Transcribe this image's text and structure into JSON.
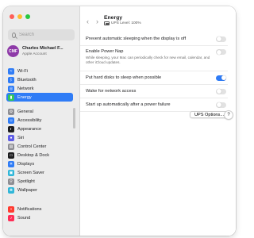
{
  "window": {
    "traffic_lights": [
      {
        "name": "close",
        "color": "#ff5f57"
      },
      {
        "name": "minimize",
        "color": "#febc2e"
      },
      {
        "name": "zoom",
        "color": "#28c840"
      }
    ]
  },
  "sidebar": {
    "search_placeholder": "Search",
    "account": {
      "initials": "CMF",
      "name": "Charles Michael F...",
      "subtitle": "Apple Account"
    },
    "groups": [
      {
        "items": [
          {
            "label": "Wi-Fi",
            "icon": "wifi-icon",
            "color": "#2f7cf6",
            "glyph": "≈",
            "selected": false
          },
          {
            "label": "Bluetooth",
            "icon": "bluetooth-icon",
            "color": "#2f7cf6",
            "glyph": "ᛒ",
            "selected": false
          },
          {
            "label": "Network",
            "icon": "network-icon",
            "color": "#2f7cf6",
            "glyph": "◎",
            "selected": false
          },
          {
            "label": "Energy",
            "icon": "energy-icon",
            "color": "#34c759",
            "glyph": "▮",
            "selected": true
          }
        ]
      },
      {
        "items": [
          {
            "label": "General",
            "icon": "general-icon",
            "color": "#8e8e93",
            "glyph": "⚙",
            "selected": false
          },
          {
            "label": "Accessibility",
            "icon": "accessibility-icon",
            "color": "#2f7cf6",
            "glyph": "☺",
            "selected": false
          },
          {
            "label": "Appearance",
            "icon": "appearance-icon",
            "color": "#1d1d1f",
            "glyph": "◐",
            "selected": false
          },
          {
            "label": "Siri",
            "icon": "siri-icon",
            "color": "#5e5ce6",
            "glyph": "●",
            "selected": false
          },
          {
            "label": "Control Center",
            "icon": "control-center-icon",
            "color": "#8e8e93",
            "glyph": "▤",
            "selected": false
          },
          {
            "label": "Desktop & Dock",
            "icon": "desktop-dock-icon",
            "color": "#1d1d1f",
            "glyph": "▭",
            "selected": false
          },
          {
            "label": "Displays",
            "icon": "displays-icon",
            "color": "#2f7cf6",
            "glyph": "✳",
            "selected": false
          },
          {
            "label": "Screen Saver",
            "icon": "screen-saver-icon",
            "color": "#2fb6d8",
            "glyph": "▣",
            "selected": false
          },
          {
            "label": "Spotlight",
            "icon": "spotlight-icon",
            "color": "#8e8e93",
            "glyph": "⚲",
            "selected": false
          },
          {
            "label": "Wallpaper",
            "icon": "wallpaper-icon",
            "color": "#2fb6d8",
            "glyph": "❀",
            "selected": false
          }
        ]
      },
      {
        "items": [
          {
            "label": "Notifications",
            "icon": "notifications-icon",
            "color": "#ff3b30",
            "glyph": "▪",
            "selected": false
          },
          {
            "label": "Sound",
            "icon": "sound-icon",
            "color": "#ff2d55",
            "glyph": "♪",
            "selected": false
          }
        ]
      }
    ]
  },
  "content": {
    "back_glyph": "‹",
    "forward_glyph": "›",
    "title": "Energy",
    "ups_level": "UPS Level: 100%",
    "settings": [
      {
        "label": "Prevent automatic sleeping when the display is off",
        "description": "",
        "on": false
      },
      {
        "label": "Enable Power Nap",
        "description": "While sleeping, your Mac can periodically check for new email, calendar, and other iCloud updates.",
        "on": false
      },
      {
        "label": "Put hard disks to sleep when possible",
        "description": "",
        "on": true
      },
      {
        "label": "Wake for network access",
        "description": "",
        "on": false
      },
      {
        "label": "Start up automatically after a power failure",
        "description": "",
        "on": false
      }
    ],
    "ups_button_label": "UPS Options...",
    "help_label": "?"
  },
  "colors": {
    "accent": "#2f7cf6",
    "sidebar_bg": "#ececec"
  }
}
